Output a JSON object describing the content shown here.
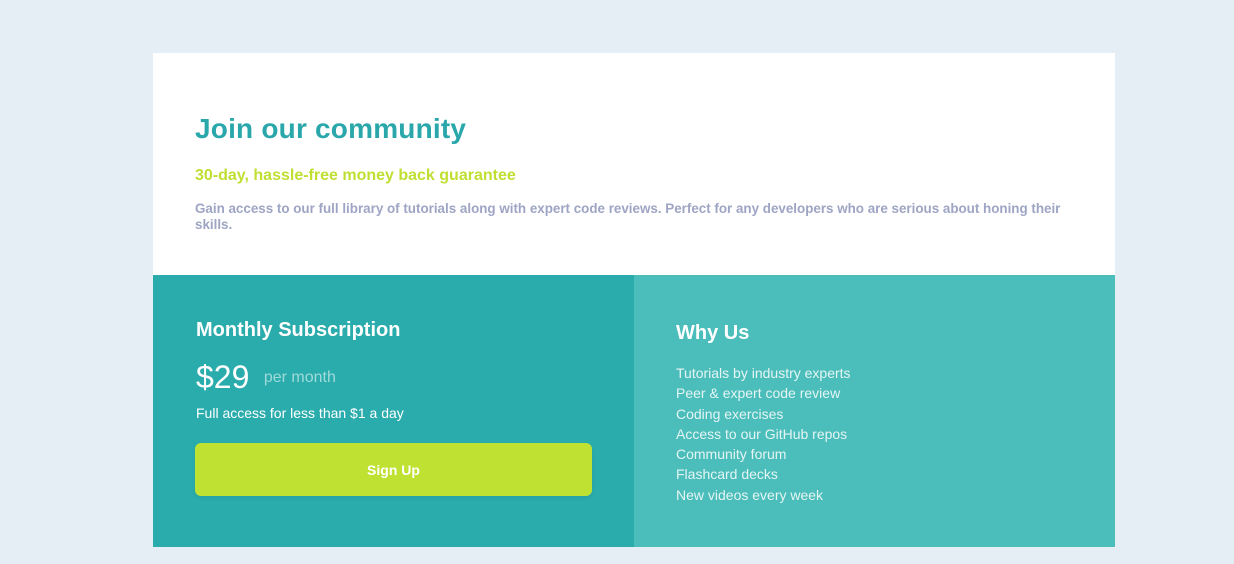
{
  "hero": {
    "title": "Join our community",
    "guarantee": "30-day, hassle-free money back guarantee",
    "description": "Gain access to our full library of tutorials along with expert code reviews. Perfect for any developers who are serious about honing their skills."
  },
  "subscription": {
    "heading": "Monthly Subscription",
    "price": "$29",
    "period": "per month",
    "note": "Full access for less than $1 a day",
    "button_label": "Sign Up"
  },
  "why_us": {
    "heading": "Why Us",
    "items": [
      "Tutorials by industry experts",
      "Peer & expert code review",
      "Coding exercises",
      "Access to our GitHub repos",
      "Community forum",
      "Flashcard decks",
      "New videos every week"
    ]
  },
  "colors": {
    "page_background": "#e5edf5",
    "accent_teal": "#2aa7aa",
    "accent_lime": "#bfdf32",
    "left_panel": "#2aabac",
    "right_panel": "#4bbdba",
    "muted_text": "#9ea5c4"
  }
}
